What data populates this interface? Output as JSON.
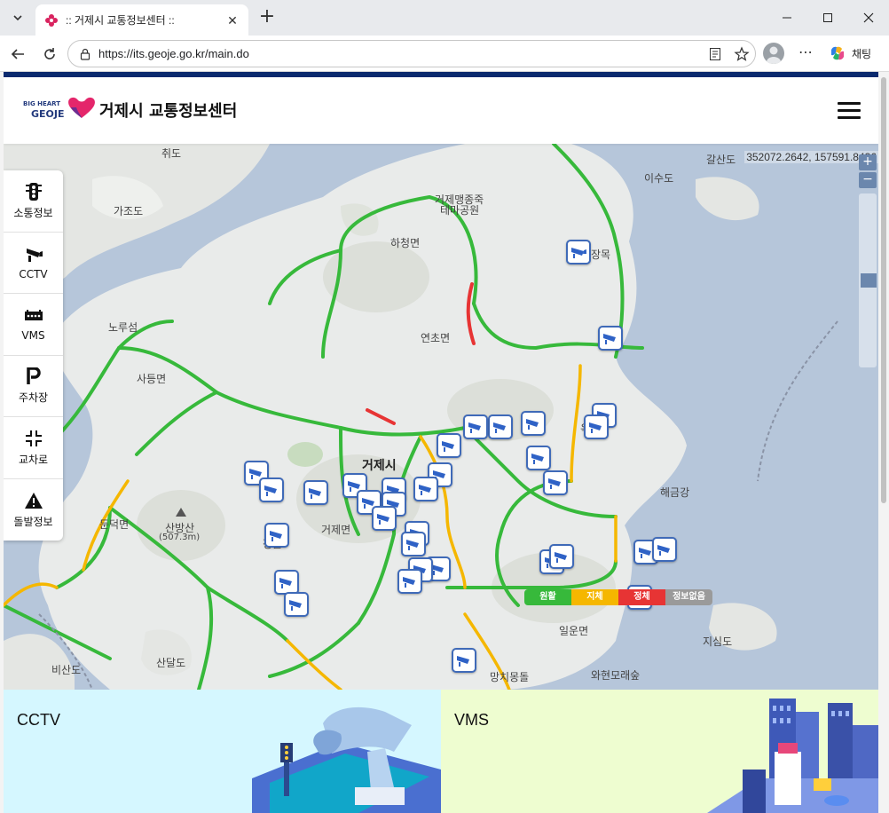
{
  "browser": {
    "tab_title": ":: 거제시 교통정보센터 ::",
    "url": "https://its.geoje.go.kr/main.do",
    "copilot_label": "채팅"
  },
  "header": {
    "logo_line1": "BIG HEART",
    "logo_line2": "GEOJE",
    "title": "거제시 교통정보센터"
  },
  "sidebar": {
    "items": [
      {
        "label": "소통정보",
        "icon": "traffic-light-icon"
      },
      {
        "label": "CCTV",
        "icon": "cctv-camera-icon"
      },
      {
        "label": "VMS",
        "icon": "vms-board-icon"
      },
      {
        "label": "주차장",
        "icon": "parking-icon"
      },
      {
        "label": "교차로",
        "icon": "intersection-icon"
      },
      {
        "label": "돌발정보",
        "icon": "warning-icon"
      }
    ]
  },
  "map": {
    "coords": "352072.2642, 157591.8436",
    "zoom_in": "+",
    "zoom_out": "−",
    "labels": {
      "chwido": "취도",
      "gajodo": "가조도",
      "hacheong": "하청면",
      "yeoncho": "연초면",
      "noru": "노루섬",
      "sadeung": "사등면",
      "geoje": "거제시",
      "dundeok": "둔덕면",
      "sanbangsan": "산방산",
      "sanbangsan_height": "(507.3m)",
      "geojemyeon": "거제면",
      "jeonggol": "정골",
      "jukrim": "죽림",
      "ilun": "일운면",
      "jisimdo": "지심도",
      "sandaldo": "산달도",
      "bisando": "비산도",
      "galsando": "갈산도",
      "isudo": "이수도",
      "geojemaeng": "거제맹종죽",
      "tema": "테마공원",
      "jangmok": "장목",
      "okpo": "옥포",
      "haegeum": "해금강",
      "waheon": "와현모래숲",
      "mangchi": "망치몽돌"
    }
  },
  "legend": {
    "smooth": "원활",
    "slow": "지체",
    "jam": "정체",
    "no_info": "정보없음",
    "colors": {
      "smooth": "#37b93b",
      "slow": "#f5b700",
      "jam": "#e73434",
      "no_info": "#9a9a9a"
    }
  },
  "panels": {
    "cctv": "CCTV",
    "vms": "VMS"
  }
}
